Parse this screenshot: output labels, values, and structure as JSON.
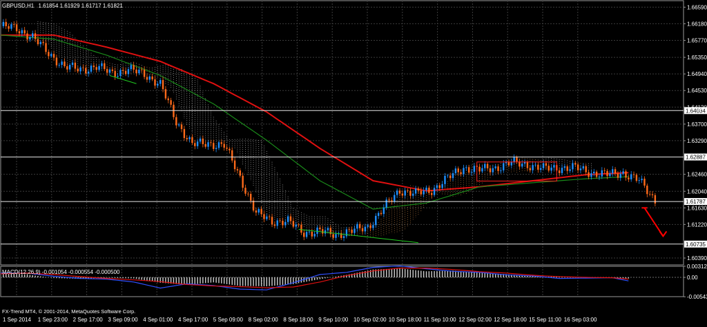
{
  "window": {
    "symbol_timeframe": "GBPUSD,H1",
    "ohlc": "1.61854 1.61929 1.61717 1.61821",
    "indicator_label": "MACD(12,26,9) -0.001054 -0.000554 -0.000500",
    "copyright": "FX-Trend MT4, © 2001-2014, MetaQuotes Software Corp."
  },
  "colors": {
    "background": "#000000",
    "grid": "#3c3c3c",
    "bull_candle": "#1e90ff",
    "bear_candle": "#ff6a1a",
    "sma_red": "#e01010",
    "sma_green": "#1a8a1a",
    "ichimoku_cloud_bear": "#d8d8d8",
    "ichimoku_cloud_bull": "#d8904a",
    "trendline_red": "#ff2020",
    "trendline_green": "#20cc20",
    "macd_hist": "#d0d0d0",
    "macd_line": "#3050ff",
    "macd_signal": "#e01010",
    "arrow_down": "#ff0000",
    "price_label_bg": "#ffffff",
    "axis_text": "#ffffff"
  },
  "chart_data": [
    {
      "type": "line",
      "title": "GBPUSD,H1",
      "y_ticks": [
        "1.66590",
        "1.66180",
        "1.65770",
        "1.65350",
        "1.64940",
        "1.64530",
        "1.64120",
        "1.63700",
        "1.63290",
        "1.62460",
        "1.62040",
        "1.61630",
        "1.61220",
        "1.60390"
      ],
      "level_labels": [
        "1.64034",
        "1.62887",
        "1.61787",
        "1.60735"
      ],
      "ylim": [
        1.6022,
        1.6675
      ],
      "x_tick_labels": [
        "1 Sep 2014",
        "1 Sep 23:00",
        "2 Sep 17:00",
        "3 Sep 09:00",
        "4 Sep 01:00",
        "4 Sep 17:00",
        "5 Sep 09:00",
        "8 Sep 02:00",
        "8 Sep 18:00",
        "9 Sep 10:00",
        "10 Sep 02:00",
        "10 Sep 18:00",
        "11 Sep 10:00",
        "12 Sep 02:00",
        "12 Sep 18:00",
        "15 Sep 11:00",
        "16 Sep 03:00"
      ],
      "xlim": [
        0,
        252
      ],
      "series": [
        {
          "x": [
            0,
            6,
            12,
            18,
            24,
            30,
            36,
            42,
            48,
            54,
            60,
            66,
            72,
            78,
            84,
            90,
            96,
            102,
            108,
            114,
            120,
            126,
            132,
            138,
            144,
            150,
            156,
            162,
            168,
            174,
            180,
            186,
            192,
            198,
            204,
            210,
            216,
            222,
            228,
            234,
            240,
            246
          ],
          "values": [
            1.6612,
            1.6606,
            1.6585,
            1.6545,
            1.6512,
            1.6505,
            1.6512,
            1.6496,
            1.6505,
            1.6494,
            1.6468,
            1.6376,
            1.632,
            1.6322,
            1.6318,
            1.6238,
            1.615,
            1.613,
            1.613,
            1.6102,
            1.6105,
            1.6097,
            1.6106,
            1.6116,
            1.6162,
            1.6207,
            1.6198,
            1.6207,
            1.6236,
            1.6262,
            1.6257,
            1.6262,
            1.6275,
            1.627,
            1.626,
            1.6262,
            1.6262,
            1.625,
            1.6245,
            1.625,
            1.623,
            1.6182
          ]
        },
        {
          "name": "",
          "x": [
            0,
            20,
            40,
            60,
            80,
            100,
            120,
            140,
            160,
            180,
            200,
            220,
            236
          ],
          "values": [
            1.659,
            1.659,
            1.656,
            1.6525,
            1.647,
            1.64,
            1.631,
            1.623,
            1.6205,
            1.6215,
            1.623,
            1.6245,
            1.625
          ]
        },
        {
          "name": "",
          "x": [
            0,
            20,
            40,
            60,
            80,
            100,
            120,
            140,
            160,
            180,
            200,
            220,
            236
          ],
          "values": [
            1.659,
            1.658,
            1.654,
            1.649,
            1.642,
            1.633,
            1.623,
            1.616,
            1.6175,
            1.6215,
            1.6225,
            1.6235,
            1.624
          ]
        }
      ],
      "annotations": [
        {
          "kind": "trendline_support",
          "x": [
            41,
            51
          ],
          "values": [
            1.649,
            1.647
          ]
        },
        {
          "kind": "trendline_support",
          "x": [
            112,
            157
          ],
          "values": [
            1.611,
            1.6077
          ]
        },
        {
          "kind": "channel",
          "x": [
            179,
            209
          ],
          "values": [
            1.6273,
            1.626
          ]
        },
        {
          "kind": "arrow_down",
          "x": [
            242,
            249
          ],
          "values": [
            1.6163,
            1.6093
          ]
        }
      ]
    },
    {
      "type": "bar",
      "title": "MACD(12,26,9) -0.001054 -0.000554 -0.000500",
      "y_ticks": [
        "0.003121",
        "0.00",
        "-0.005436"
      ],
      "ylim": [
        -0.0054,
        0.0031
      ],
      "xlim": [
        0,
        252
      ],
      "series": [
        {
          "x": [
            0,
            10,
            20,
            30,
            40,
            50,
            60,
            70,
            80,
            90,
            100,
            110,
            120,
            130,
            140,
            150,
            160,
            170,
            180,
            190,
            200,
            210,
            220,
            230,
            236
          ],
          "values": [
            0.0011,
            0.0008,
            -0.0002,
            -0.0004,
            -0.0001,
            -0.0003,
            -0.0015,
            -0.0021,
            -0.0014,
            -0.0024,
            -0.0025,
            -0.0019,
            -0.0005,
            0.0007,
            0.0022,
            0.0025,
            0.0017,
            0.0019,
            0.0013,
            0.0009,
            0.0003,
            0.0001,
            -0.0001,
            -0.0001,
            -0.0003
          ]
        },
        {
          "x": [
            0,
            10,
            20,
            30,
            40,
            50,
            60,
            70,
            80,
            90,
            100,
            110,
            120,
            130,
            140,
            150,
            160,
            170,
            180,
            190,
            200,
            210,
            220,
            230,
            236
          ],
          "values": [
            0.0012,
            0.0012,
            0.0003,
            -0.0003,
            -0.0005,
            -0.0013,
            -0.003,
            -0.0018,
            -0.0023,
            -0.0033,
            -0.0035,
            -0.0015,
            0.0008,
            0.0014,
            0.0028,
            0.0032,
            0.0024,
            0.0017,
            0.0014,
            0.0007,
            0.0004,
            -0.0003,
            -0.0002,
            -0.0001,
            -0.001
          ]
        },
        {
          "x": [
            0,
            10,
            20,
            30,
            40,
            50,
            60,
            70,
            80,
            90,
            100,
            110,
            120,
            130,
            140,
            150,
            160,
            170,
            180,
            190,
            200,
            210,
            220,
            230,
            236
          ],
          "values": [
            0.001,
            0.0012,
            0.0008,
            0.0002,
            -0.0003,
            -0.0007,
            -0.0012,
            -0.002,
            -0.0024,
            -0.0026,
            -0.0029,
            -0.0027,
            -0.0013,
            0.0005,
            0.0018,
            0.0026,
            0.0026,
            0.0022,
            0.0016,
            0.0012,
            0.0006,
            0.0002,
            0.0,
            -0.0001,
            -0.0005
          ]
        }
      ]
    }
  ]
}
